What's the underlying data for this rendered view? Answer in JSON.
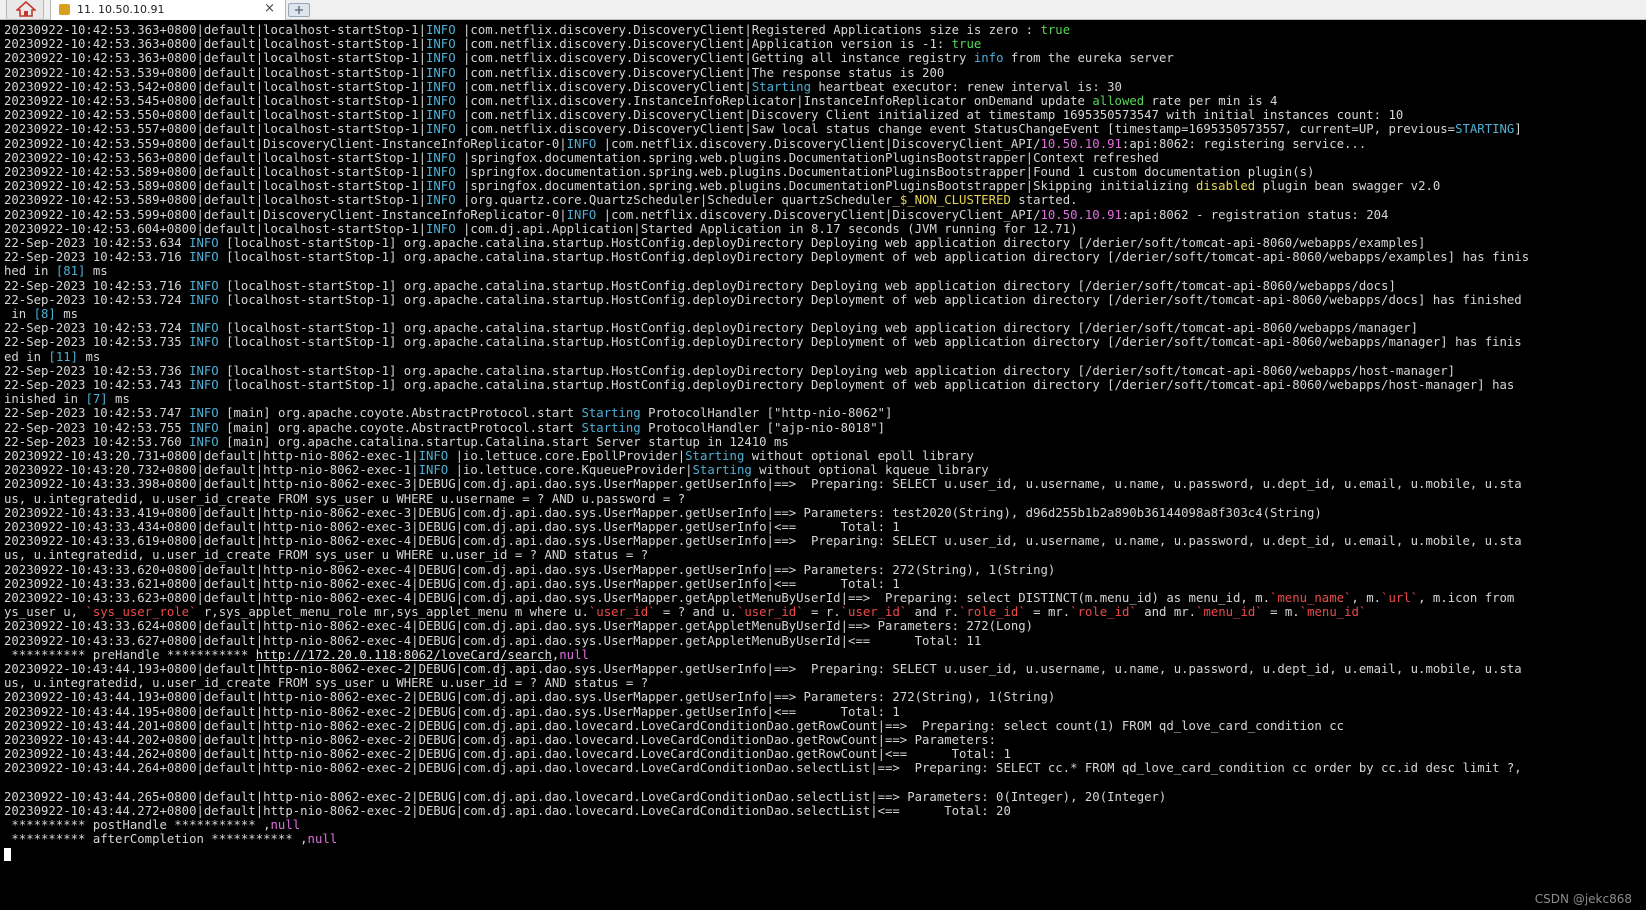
{
  "tab": {
    "session_title": "11. 10.50.10.91",
    "close_glyph": "×"
  },
  "colors": {
    "info": "#4fb0d4",
    "keyword_true": "#56d656",
    "ip": "#e070e0",
    "number": "#4fb0d4",
    "highlight": "#e8d650",
    "sql_column": "#ec4a4a",
    "null": "#e070e0"
  },
  "watermark": "CSDN @jekc868",
  "lines": [
    [
      {
        "t": "20230922-10:42:53.363+0800|default|localhost-startStop-1|"
      },
      {
        "t": "INFO",
        "c": "info"
      },
      {
        "t": " |com.netflix.discovery.DiscoveryClient|Registered Applications size is zero : "
      },
      {
        "t": "true",
        "c": "true"
      }
    ],
    [
      {
        "t": "20230922-10:42:53.363+0800|default|localhost-startStop-1|"
      },
      {
        "t": "INFO",
        "c": "info"
      },
      {
        "t": " |com.netflix.discovery.DiscoveryClient|Application version is -1: "
      },
      {
        "t": "true",
        "c": "true"
      }
    ],
    [
      {
        "t": "20230922-10:42:53.363+0800|default|localhost-startStop-1|"
      },
      {
        "t": "INFO",
        "c": "info"
      },
      {
        "t": " |com.netflix.discovery.DiscoveryClient|Getting all instance registry "
      },
      {
        "t": "info",
        "c": "info"
      },
      {
        "t": " from the eureka server"
      }
    ],
    [
      {
        "t": "20230922-10:42:53.539+0800|default|localhost-startStop-1|"
      },
      {
        "t": "INFO",
        "c": "info"
      },
      {
        "t": " |com.netflix.discovery.DiscoveryClient|The response status is 200"
      }
    ],
    [
      {
        "t": "20230922-10:42:53.542+0800|default|localhost-startStop-1|"
      },
      {
        "t": "INFO",
        "c": "info"
      },
      {
        "t": " |com.netflix.discovery.DiscoveryClient|"
      },
      {
        "t": "Starting",
        "c": "info"
      },
      {
        "t": " heartbeat executor: renew interval is: 30"
      }
    ],
    [
      {
        "t": "20230922-10:42:53.545+0800|default|localhost-startStop-1|"
      },
      {
        "t": "INFO",
        "c": "info"
      },
      {
        "t": " |com.netflix.discovery.InstanceInfoReplicator|InstanceInfoReplicator onDemand update "
      },
      {
        "t": "allowed",
        "c": "true"
      },
      {
        "t": " rate per min is 4"
      }
    ],
    [
      {
        "t": "20230922-10:42:53.550+0800|default|localhost-startStop-1|"
      },
      {
        "t": "INFO",
        "c": "info"
      },
      {
        "t": " |com.netflix.discovery.DiscoveryClient|Discovery Client initialized at timestamp 1695350573547 with initial instances count: 10"
      }
    ],
    [
      {
        "t": "20230922-10:42:53.557+0800|default|localhost-startStop-1|"
      },
      {
        "t": "INFO",
        "c": "info"
      },
      {
        "t": " |com.netflix.discovery.DiscoveryClient|Saw local status change event StatusChangeEvent [timestamp=1695350573557, current=UP, previous="
      },
      {
        "t": "STARTING",
        "c": "info"
      },
      {
        "t": "]"
      }
    ],
    [
      {
        "t": "20230922-10:42:53.559+0800|default|DiscoveryClient-InstanceInfoReplicator-0|"
      },
      {
        "t": "INFO",
        "c": "info"
      },
      {
        "t": " |com.netflix.discovery.DiscoveryClient|DiscoveryClient_API/"
      },
      {
        "t": "10.50.10.91",
        "c": "ip"
      },
      {
        "t": ":api:8062: registering service..."
      }
    ],
    [
      {
        "t": "20230922-10:42:53.563+0800|default|localhost-startStop-1|"
      },
      {
        "t": "INFO",
        "c": "info"
      },
      {
        "t": " |springfox.documentation.spring.web.plugins.DocumentationPluginsBootstrapper|Context refreshed"
      }
    ],
    [
      {
        "t": "20230922-10:42:53.589+0800|default|localhost-startStop-1|"
      },
      {
        "t": "INFO",
        "c": "info"
      },
      {
        "t": " |springfox.documentation.spring.web.plugins.DocumentationPluginsBootstrapper|Found 1 custom documentation plugin(s)"
      }
    ],
    [
      {
        "t": "20230922-10:42:53.589+0800|default|localhost-startStop-1|"
      },
      {
        "t": "INFO",
        "c": "info"
      },
      {
        "t": " |springfox.documentation.spring.web.plugins.DocumentationPluginsBootstrapper|Skipping initializing "
      },
      {
        "t": "disabled",
        "c": "warn"
      },
      {
        "t": " plugin bean swagger v2.0"
      }
    ],
    [
      {
        "t": "20230922-10:42:53.589+0800|default|localhost-startStop-1|"
      },
      {
        "t": "INFO",
        "c": "info"
      },
      {
        "t": " |org.quartz.core.QuartzScheduler|Scheduler quartzScheduler_"
      },
      {
        "t": "$_NON_CLUSTERED",
        "c": "warn"
      },
      {
        "t": " started."
      }
    ],
    [
      {
        "t": "20230922-10:42:53.599+0800|default|DiscoveryClient-InstanceInfoReplicator-0|"
      },
      {
        "t": "INFO",
        "c": "info"
      },
      {
        "t": " |com.netflix.discovery.DiscoveryClient|DiscoveryClient_API/"
      },
      {
        "t": "10.50.10.91",
        "c": "ip"
      },
      {
        "t": ":api:8062 - registration status: 204"
      }
    ],
    [
      {
        "t": "20230922-10:42:53.604+0800|default|localhost-startStop-1|"
      },
      {
        "t": "INFO",
        "c": "info"
      },
      {
        "t": " |com.dj.api.Application|Started Application in 8.17 seconds (JVM running for 12.71)"
      }
    ],
    [
      {
        "t": "22-Sep-2023 10:42:53.634 "
      },
      {
        "t": "INFO",
        "c": "info"
      },
      {
        "t": " [localhost-startStop-1] org.apache.catalina.startup.HostConfig.deployDirectory Deploying web application directory [/derier/soft/tomcat-api-8060/webapps/examples]"
      }
    ],
    [
      {
        "t": "22-Sep-2023 10:42:53.716 "
      },
      {
        "t": "INFO",
        "c": "info"
      },
      {
        "t": " [localhost-startStop-1] org.apache.catalina.startup.HostConfig.deployDirectory Deployment of web application directory [/derier/soft/tomcat-api-8060/webapps/examples] has finis"
      }
    ],
    [
      {
        "t": "hed in "
      },
      {
        "t": "[81]",
        "c": "num"
      },
      {
        "t": " ms"
      }
    ],
    [
      {
        "t": "22-Sep-2023 10:42:53.716 "
      },
      {
        "t": "INFO",
        "c": "info"
      },
      {
        "t": " [localhost-startStop-1] org.apache.catalina.startup.HostConfig.deployDirectory Deploying web application directory [/derier/soft/tomcat-api-8060/webapps/docs]"
      }
    ],
    [
      {
        "t": "22-Sep-2023 10:42:53.724 "
      },
      {
        "t": "INFO",
        "c": "info"
      },
      {
        "t": " [localhost-startStop-1] org.apache.catalina.startup.HostConfig.deployDirectory Deployment of web application directory [/derier/soft/tomcat-api-8060/webapps/docs] has finished"
      }
    ],
    [
      {
        "t": " in "
      },
      {
        "t": "[8]",
        "c": "num"
      },
      {
        "t": " ms"
      }
    ],
    [
      {
        "t": "22-Sep-2023 10:42:53.724 "
      },
      {
        "t": "INFO",
        "c": "info"
      },
      {
        "t": " [localhost-startStop-1] org.apache.catalina.startup.HostConfig.deployDirectory Deploying web application directory [/derier/soft/tomcat-api-8060/webapps/manager]"
      }
    ],
    [
      {
        "t": "22-Sep-2023 10:42:53.735 "
      },
      {
        "t": "INFO",
        "c": "info"
      },
      {
        "t": " [localhost-startStop-1] org.apache.catalina.startup.HostConfig.deployDirectory Deployment of web application directory [/derier/soft/tomcat-api-8060/webapps/manager] has finis"
      }
    ],
    [
      {
        "t": "ed in "
      },
      {
        "t": "[11]",
        "c": "num"
      },
      {
        "t": " ms"
      }
    ],
    [
      {
        "t": "22-Sep-2023 10:42:53.736 "
      },
      {
        "t": "INFO",
        "c": "info"
      },
      {
        "t": " [localhost-startStop-1] org.apache.catalina.startup.HostConfig.deployDirectory Deploying web application directory [/derier/soft/tomcat-api-8060/webapps/host-manager]"
      }
    ],
    [
      {
        "t": "22-Sep-2023 10:42:53.743 "
      },
      {
        "t": "INFO",
        "c": "info"
      },
      {
        "t": " [localhost-startStop-1] org.apache.catalina.startup.HostConfig.deployDirectory Deployment of web application directory [/derier/soft/tomcat-api-8060/webapps/host-manager] has"
      }
    ],
    [
      {
        "t": "inished in "
      },
      {
        "t": "[7]",
        "c": "num"
      },
      {
        "t": " ms"
      }
    ],
    [
      {
        "t": "22-Sep-2023 10:42:53.747 "
      },
      {
        "t": "INFO",
        "c": "info"
      },
      {
        "t": " [main] org.apache.coyote.AbstractProtocol.start "
      },
      {
        "t": "Starting",
        "c": "info"
      },
      {
        "t": " ProtocolHandler [\"http-nio-8062\"]"
      }
    ],
    [
      {
        "t": "22-Sep-2023 10:42:53.755 "
      },
      {
        "t": "INFO",
        "c": "info"
      },
      {
        "t": " [main] org.apache.coyote.AbstractProtocol.start "
      },
      {
        "t": "Starting",
        "c": "info"
      },
      {
        "t": " ProtocolHandler [\"ajp-nio-8018\"]"
      }
    ],
    [
      {
        "t": "22-Sep-2023 10:42:53.760 "
      },
      {
        "t": "INFO",
        "c": "info"
      },
      {
        "t": " [main] org.apache.catalina.startup.Catalina.start Server startup in 12410 ms"
      }
    ],
    [
      {
        "t": "20230922-10:43:20.731+0800|default|http-nio-8062-exec-1|"
      },
      {
        "t": "INFO",
        "c": "info"
      },
      {
        "t": " |io.lettuce.core.EpollProvider|"
      },
      {
        "t": "Starting",
        "c": "info"
      },
      {
        "t": " without optional epoll library"
      }
    ],
    [
      {
        "t": "20230922-10:43:20.732+0800|default|http-nio-8062-exec-1|"
      },
      {
        "t": "INFO",
        "c": "info"
      },
      {
        "t": " |io.lettuce.core.KqueueProvider|"
      },
      {
        "t": "Starting",
        "c": "info"
      },
      {
        "t": " without optional kqueue library"
      }
    ],
    [
      {
        "t": "20230922-10:43:33.398+0800|default|http-nio-8062-exec-3|DEBUG|com.dj.api.dao.sys.UserMapper.getUserInfo|==>  Preparing: SELECT u.user_id, u.username, u.name, u.password, u.dept_id, u.email, u.mobile, u.sta"
      }
    ],
    [
      {
        "t": "us, u.integratedid, u.user_id_create FROM sys_user u WHERE u.username = ? AND u.password = ?"
      }
    ],
    [
      {
        "t": "20230922-10:43:33.419+0800|default|http-nio-8062-exec-3|DEBUG|com.dj.api.dao.sys.UserMapper.getUserInfo|==> Parameters: test2020(String), d96d255b1b2a890b36144098a8f303c4(String)"
      }
    ],
    [
      {
        "t": "20230922-10:43:33.434+0800|default|http-nio-8062-exec-3|DEBUG|com.dj.api.dao.sys.UserMapper.getUserInfo|<==      Total: 1"
      }
    ],
    [
      {
        "t": "20230922-10:43:33.619+0800|default|http-nio-8062-exec-4|DEBUG|com.dj.api.dao.sys.UserMapper.getUserInfo|==>  Preparing: SELECT u.user_id, u.username, u.name, u.password, u.dept_id, u.email, u.mobile, u.sta"
      }
    ],
    [
      {
        "t": "us, u.integratedid, u.user_id_create FROM sys_user u WHERE u.user_id = ? AND status = ?"
      }
    ],
    [
      {
        "t": "20230922-10:43:33.620+0800|default|http-nio-8062-exec-4|DEBUG|com.dj.api.dao.sys.UserMapper.getUserInfo|==> Parameters: 272(String), 1(String)"
      }
    ],
    [
      {
        "t": "20230922-10:43:33.621+0800|default|http-nio-8062-exec-4|DEBUG|com.dj.api.dao.sys.UserMapper.getUserInfo|<==      Total: 1"
      }
    ],
    [
      {
        "t": "20230922-10:43:33.623+0800|default|http-nio-8062-exec-4|DEBUG|com.dj.api.dao.sys.UserMapper.getAppletMenuByUserId|==>  Preparing: select DISTINCT(m.menu_id) as menu_id, m."
      },
      {
        "t": "`menu_name`",
        "c": "red"
      },
      {
        "t": ", m."
      },
      {
        "t": "`url`",
        "c": "red"
      },
      {
        "t": ", m.icon from"
      }
    ],
    [
      {
        "t": "ys_user u, "
      },
      {
        "t": "`sys_user_role`",
        "c": "red"
      },
      {
        "t": " r,sys_applet_menu_role mr,sys_applet_menu m where u."
      },
      {
        "t": "`user_id`",
        "c": "red"
      },
      {
        "t": " = ? and u."
      },
      {
        "t": "`user_id`",
        "c": "red"
      },
      {
        "t": " = r."
      },
      {
        "t": "`user_id`",
        "c": "red"
      },
      {
        "t": " and r."
      },
      {
        "t": "`role_id`",
        "c": "red"
      },
      {
        "t": " = mr."
      },
      {
        "t": "`role_id`",
        "c": "red"
      },
      {
        "t": " and mr."
      },
      {
        "t": "`menu_id`",
        "c": "red"
      },
      {
        "t": " = m."
      },
      {
        "t": "`menu_id`",
        "c": "red"
      }
    ],
    [
      {
        "t": "20230922-10:43:33.624+0800|default|http-nio-8062-exec-4|DEBUG|com.dj.api.dao.sys.UserMapper.getAppletMenuByUserId|==> Parameters: 272(Long)"
      }
    ],
    [
      {
        "t": "20230922-10:43:33.627+0800|default|http-nio-8062-exec-4|DEBUG|com.dj.api.dao.sys.UserMapper.getAppletMenuByUserId|<==      Total: 11"
      }
    ],
    [
      {
        "t": " ********** preHandle *********** "
      },
      {
        "t": "http://172.20.0.118:8062/loveCard/search",
        "c": "link"
      },
      {
        "t": ","
      },
      {
        "t": "null",
        "c": "null"
      }
    ],
    [
      {
        "t": "20230922-10:43:44.193+0800|default|http-nio-8062-exec-2|DEBUG|com.dj.api.dao.sys.UserMapper.getUserInfo|==>  Preparing: SELECT u.user_id, u.username, u.name, u.password, u.dept_id, u.email, u.mobile, u.sta"
      }
    ],
    [
      {
        "t": "us, u.integratedid, u.user_id_create FROM sys_user u WHERE u.user_id = ? AND status = ?"
      }
    ],
    [
      {
        "t": "20230922-10:43:44.193+0800|default|http-nio-8062-exec-2|DEBUG|com.dj.api.dao.sys.UserMapper.getUserInfo|==> Parameters: 272(String), 1(String)"
      }
    ],
    [
      {
        "t": "20230922-10:43:44.195+0800|default|http-nio-8062-exec-2|DEBUG|com.dj.api.dao.sys.UserMapper.getUserInfo|<==      Total: 1"
      }
    ],
    [
      {
        "t": "20230922-10:43:44.201+0800|default|http-nio-8062-exec-2|DEBUG|com.dj.api.dao.lovecard.LoveCardConditionDao.getRowCount|==>  Preparing: select count(1) FROM qd_love_card_condition cc"
      }
    ],
    [
      {
        "t": "20230922-10:43:44.202+0800|default|http-nio-8062-exec-2|DEBUG|com.dj.api.dao.lovecard.LoveCardConditionDao.getRowCount|==> Parameters: "
      }
    ],
    [
      {
        "t": "20230922-10:43:44.262+0800|default|http-nio-8062-exec-2|DEBUG|com.dj.api.dao.lovecard.LoveCardConditionDao.getRowCount|<==      Total: 1"
      }
    ],
    [
      {
        "t": "20230922-10:43:44.264+0800|default|http-nio-8062-exec-2|DEBUG|com.dj.api.dao.lovecard.LoveCardConditionDao.selectList|==>  Preparing: SELECT cc.* FROM qd_love_card_condition cc order by cc.id desc limit ?,"
      }
    ],
    [],
    [
      {
        "t": "20230922-10:43:44.265+0800|default|http-nio-8062-exec-2|DEBUG|com.dj.api.dao.lovecard.LoveCardConditionDao.selectList|==> Parameters: 0(Integer), 20(Integer)"
      }
    ],
    [
      {
        "t": "20230922-10:43:44.272+0800|default|http-nio-8062-exec-2|DEBUG|com.dj.api.dao.lovecard.LoveCardConditionDao.selectList|<==      Total: 20"
      }
    ],
    [
      {
        "t": " ********** postHandle *********** ,"
      },
      {
        "t": "null",
        "c": "null"
      }
    ],
    [
      {
        "t": " ********** afterCompletion *********** ,"
      },
      {
        "t": "null",
        "c": "null"
      }
    ]
  ]
}
